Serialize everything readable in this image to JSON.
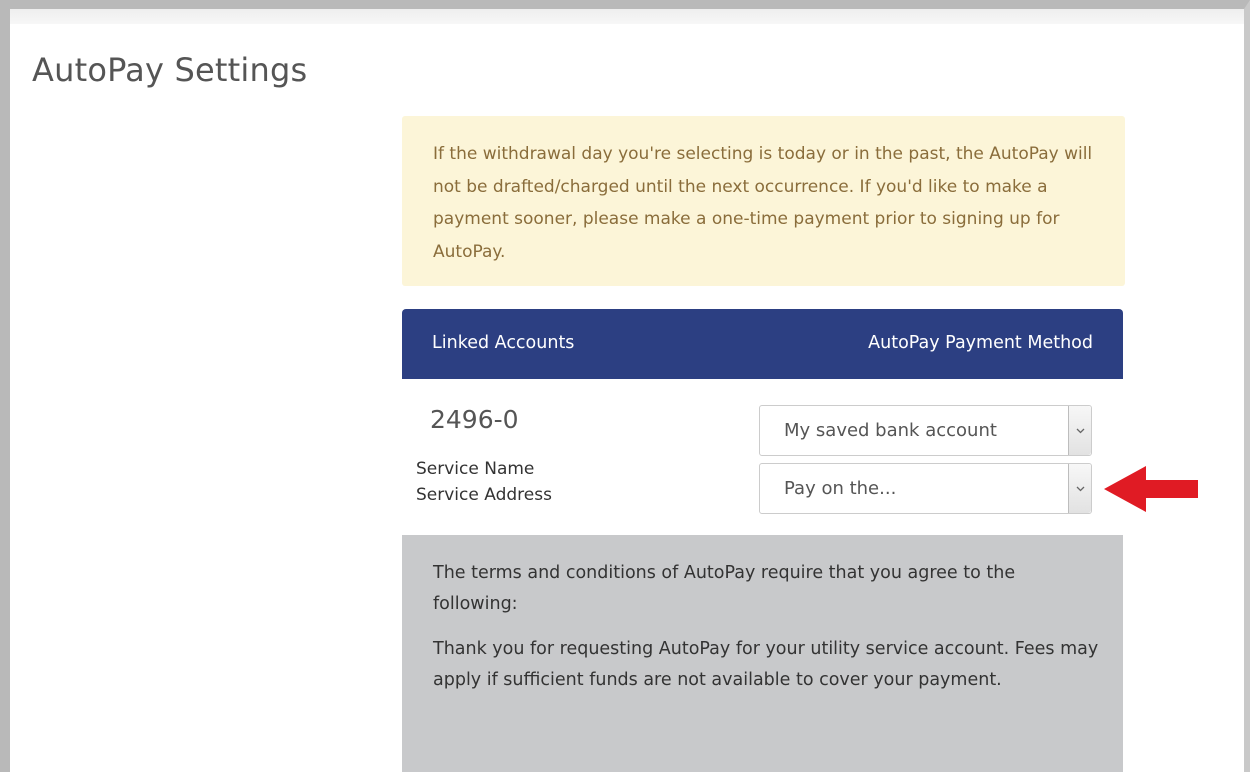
{
  "page": {
    "title": "AutoPay Settings"
  },
  "alert": {
    "text": "If the withdrawal day you're selecting is today or in the past, the AutoPay will not be drafted/charged until the next occurrence. If you'd like to make a payment sooner, please make a one-time payment prior to signing up for AutoPay."
  },
  "table": {
    "header_left": "Linked Accounts",
    "header_right": "AutoPay Payment Method",
    "account": {
      "number": "2496-0",
      "service_name": "Service Name",
      "service_address": "Service Address"
    },
    "payment_method_select": {
      "value": "My saved bank account"
    },
    "pay_day_select": {
      "value": "Pay on the..."
    }
  },
  "terms": {
    "intro": "The terms and conditions of AutoPay require that you agree to the following:",
    "body": "Thank you for requesting AutoPay for your utility service account. Fees may apply if sufficient funds are not available to cover your payment."
  },
  "colors": {
    "header_bg": "#2c3f82",
    "alert_bg": "#fcf5d8",
    "alert_text": "#8a6d3b",
    "terms_bg": "#c8c9cb",
    "arrow": "#e01b24"
  },
  "icons": {
    "select_caret": "chevron-down-icon",
    "pointer_arrow": "red-left-arrow-icon"
  }
}
